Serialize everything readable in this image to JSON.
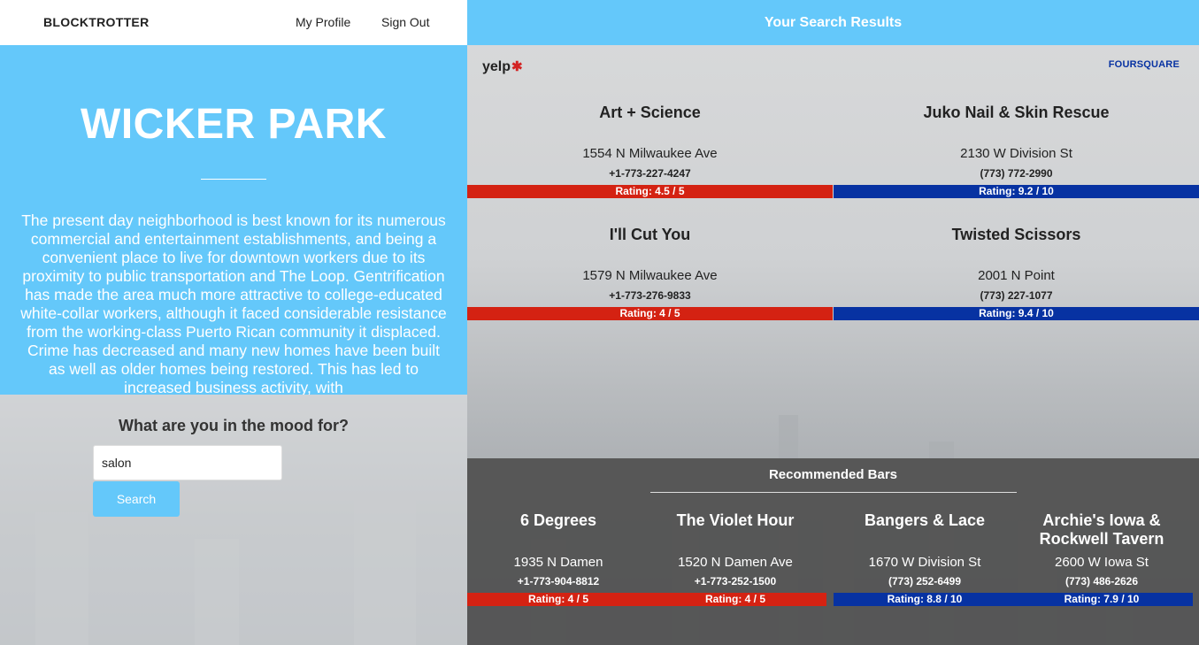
{
  "nav": {
    "brand": "BLOCKTROTTER",
    "profile": "My Profile",
    "signout": "Sign Out"
  },
  "hero": {
    "title": "WICKER PARK",
    "description": "The present day neighborhood is best known for its numerous commercial and entertainment establishments, and being a convenient place to live for downtown workers due to its proximity to public transportation and The Loop. Gentrification has made the area much more attractive to college-educated white-collar workers, although it faced considerable resistance from the working-class Puerto Rican community it displaced. Crime has decreased and many new homes have been built as well as older homes being restored. This has led to increased business activity, with"
  },
  "search": {
    "prompt": "What are you in the mood for?",
    "value": "salon",
    "button": "Search"
  },
  "results": {
    "header": "Your Search Results",
    "yelp_logo": "yelp",
    "foursquare_logo": "FOURSQUARE",
    "yelp": [
      {
        "name": "Art + Science",
        "address": "1554 N Milwaukee Ave",
        "phone": "+1-773-227-4247",
        "rating": "Rating: 4.5 / 5"
      },
      {
        "name": "I'll Cut You",
        "address": "1579 N Milwaukee Ave",
        "phone": "+1-773-276-9833",
        "rating": "Rating: 4 / 5"
      }
    ],
    "foursquare": [
      {
        "name": "Juko Nail & Skin Rescue",
        "address": "2130 W Division St",
        "phone": "(773) 772-2990",
        "rating": "Rating: 9.2 / 10"
      },
      {
        "name": "Twisted Scissors",
        "address": "2001 N Point",
        "phone": "(773) 227-1077",
        "rating": "Rating: 9.4 / 10"
      }
    ]
  },
  "bars": {
    "title": "Recommended Bars",
    "items": [
      {
        "name": "6 Degrees",
        "address": "1935 N Damen",
        "phone": "+1-773-904-8812",
        "rating": "Rating: 4 / 5",
        "source": "yelp"
      },
      {
        "name": "The Violet Hour",
        "address": "1520 N Damen Ave",
        "phone": "+1-773-252-1500",
        "rating": "Rating: 4 / 5",
        "source": "yelp"
      },
      {
        "name": "Bangers & Lace",
        "address": "1670 W Division St",
        "phone": "(773) 252-6499",
        "rating": "Rating: 8.8 / 10",
        "source": "foursquare"
      },
      {
        "name": "Archie's Iowa & Rockwell Tavern",
        "address": "2600 W Iowa St",
        "phone": "(773) 486-2626",
        "rating": "Rating: 7.9 / 10",
        "source": "foursquare"
      }
    ]
  },
  "colors": {
    "accent": "#64c8fa",
    "yelp_red": "#d42212",
    "foursquare_blue": "#0732a2"
  }
}
